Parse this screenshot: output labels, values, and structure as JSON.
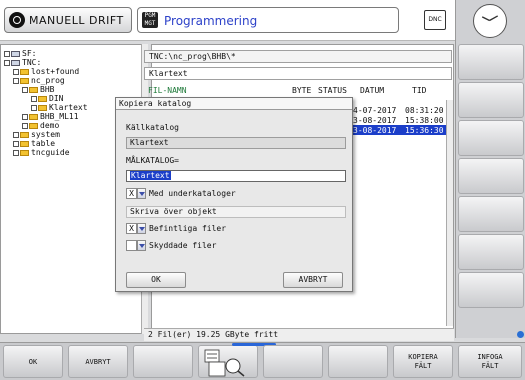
{
  "header": {
    "mode_left": "MANUELL DRIFT",
    "mode_mid": "Programmering",
    "mode_mid_icon": "PGM MGT",
    "dnc_label": "DNC"
  },
  "tree": {
    "items": [
      {
        "label": "SF:"
      },
      {
        "label": "TNC:"
      },
      {
        "label": "lost+found"
      },
      {
        "label": "nc_prog"
      },
      {
        "label": "BHB"
      },
      {
        "label": "DIN"
      },
      {
        "label": "Klartext"
      },
      {
        "label": "BHB_ML11"
      },
      {
        "label": "demo"
      },
      {
        "label": "system"
      },
      {
        "label": "table"
      },
      {
        "label": "tncguide"
      }
    ]
  },
  "files": {
    "path": "TNC:\\nc_prog\\BHB\\*",
    "type": "Klartext",
    "columns": [
      "FIL-NAMN",
      "BYTE",
      "STATUS",
      "DATUM",
      "TID"
    ],
    "rows": [
      {
        "date": "4-07-2017",
        "time": "08:31:20"
      },
      {
        "date": "3-08-2017",
        "time": "15:38:00"
      },
      {
        "date": "3-08-2017",
        "time": "15:36:30"
      }
    ],
    "status": "2    Fil(er)  19.25 GByte fritt"
  },
  "dialog": {
    "title": "Kopiera katalog",
    "source_label": "Källkatalog",
    "source_value": "Klartext",
    "target_label": "MÅLKATALOG=",
    "target_value": "Klartext",
    "subdirs_value": "X",
    "subdirs_label": "Med underkataloger",
    "overwrite_group": "Skriva över objekt",
    "existing_value": "X",
    "existing_label": "Befintliga filer",
    "protected_value": "",
    "protected_label": "Skyddade filer",
    "ok": "OK",
    "cancel": "AVBRYT"
  },
  "softkeys": {
    "ok": "OK",
    "cancel": "AVBRYT",
    "copy_fields": "KOPIERA\nFÄLT",
    "insert_fields": "INFOGA\nFÄLT"
  }
}
